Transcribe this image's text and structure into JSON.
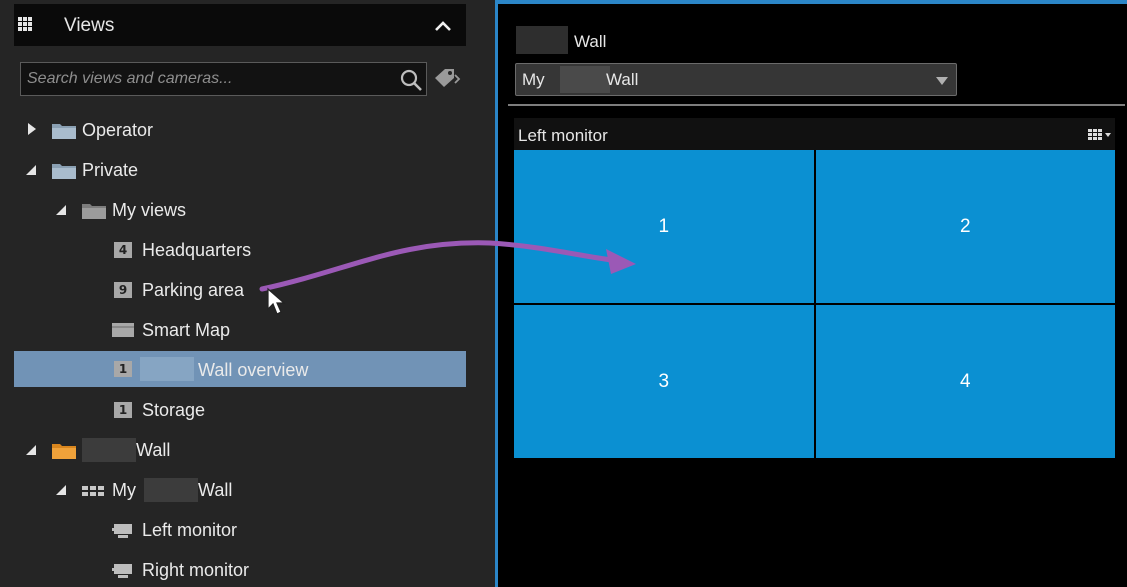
{
  "views_panel": {
    "title": "Views",
    "search_placeholder": "Search views and cameras...",
    "tree": {
      "operator": "Operator",
      "private": "Private",
      "my_views": "My views",
      "headquarters": {
        "badge": "4",
        "label": "Headquarters"
      },
      "parking": {
        "badge": "9",
        "label": "Parking area"
      },
      "smart_map": "Smart Map",
      "wall_overview": {
        "badge": "1",
        "label": "Wall overview"
      },
      "storage": {
        "badge": "1",
        "label": "Storage"
      },
      "wall_group": "Wall",
      "my_wall": {
        "prefix": "My",
        "suffix": "Wall"
      },
      "left_monitor": "Left monitor",
      "right_monitor": "Right monitor"
    }
  },
  "wall_panel": {
    "label": "Wall",
    "select": {
      "prefix": "My",
      "suffix": "Wall"
    },
    "monitor_title": "Left monitor",
    "tiles": [
      "1",
      "2",
      "3",
      "4"
    ]
  },
  "colors": {
    "accent": "#2b86c8",
    "selection": "#7193b6",
    "tile": "#0b90d2",
    "arrow": "#9b59b6"
  }
}
